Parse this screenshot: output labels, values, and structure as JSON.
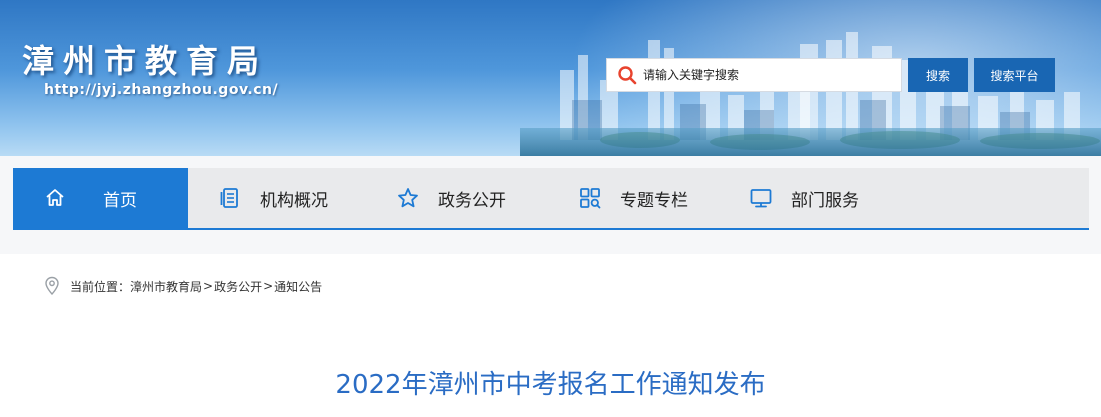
{
  "header": {
    "site_title": "漳州市教育局",
    "site_url": "http://jyj.zhangzhou.gov.cn/",
    "search": {
      "placeholder": "请输入关键字搜索",
      "value": "",
      "search_button": "搜索",
      "platform_button": "搜索平台"
    }
  },
  "nav": {
    "items": [
      {
        "label": "首页",
        "icon": "home-icon",
        "active": true
      },
      {
        "label": "机构概况",
        "icon": "document-icon",
        "active": false
      },
      {
        "label": "政务公开",
        "icon": "star-icon",
        "active": false
      },
      {
        "label": "专题专栏",
        "icon": "grid-search-icon",
        "active": false
      },
      {
        "label": "部门服务",
        "icon": "monitor-icon",
        "active": false
      }
    ]
  },
  "breadcrumb": {
    "prefix": "当前位置：",
    "items": [
      "漳州市教育局",
      "政务公开",
      "通知公告"
    ],
    "separator": ">"
  },
  "article": {
    "title": "2022年漳州市中考报名工作通知发布"
  },
  "colors": {
    "accent": "#1d7ad4",
    "button": "#1966b3",
    "title": "#2a6cc4",
    "search_icon": "#e8432e"
  }
}
